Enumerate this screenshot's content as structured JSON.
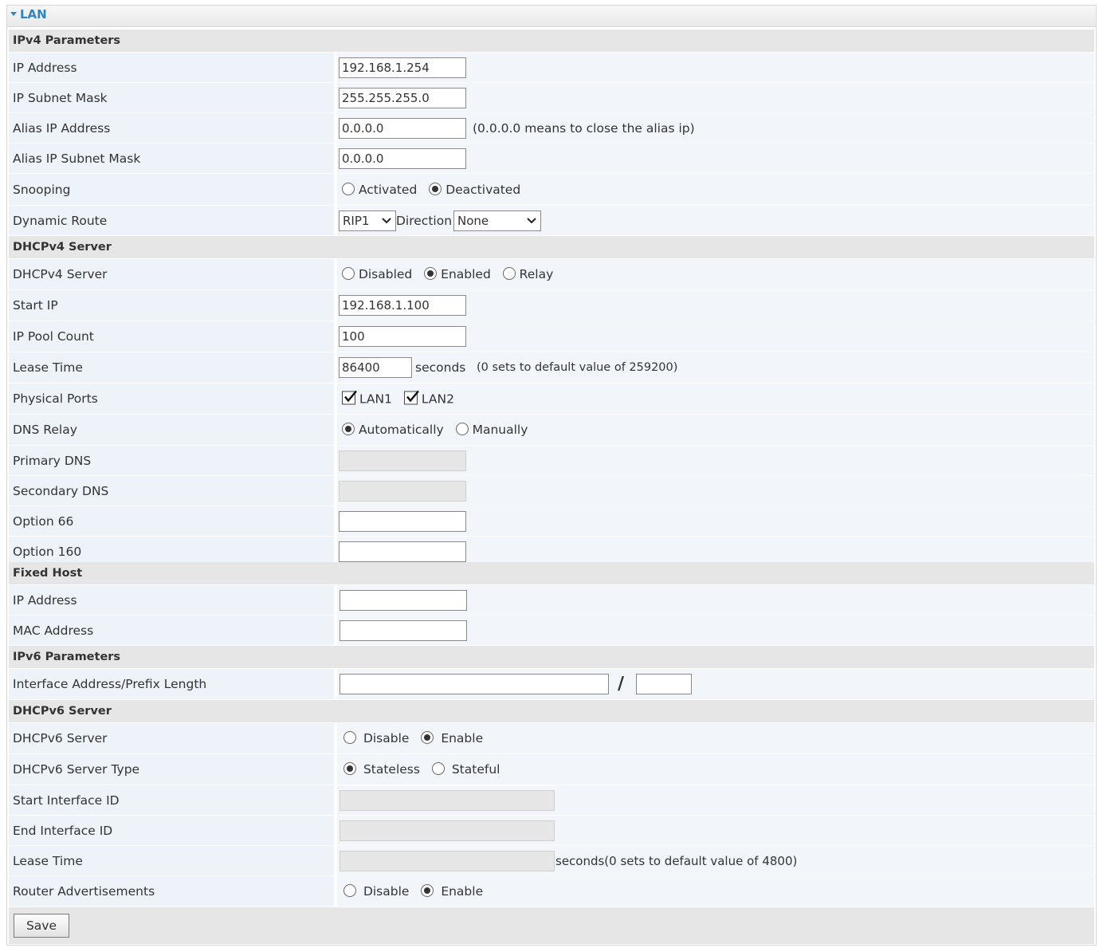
{
  "panel": {
    "title": "LAN"
  },
  "sections": {
    "ipv4": "IPv4 Parameters",
    "dhcpv4": "DHCPv4 Server",
    "fixed_host": "Fixed Host",
    "ipv6": "IPv6 Parameters",
    "dhcpv6": "DHCPv6 Server"
  },
  "ipv4": {
    "ip_address": {
      "label": "IP Address",
      "value": "192.168.1.254"
    },
    "subnet_mask": {
      "label": "IP Subnet Mask",
      "value": "255.255.255.0"
    },
    "alias_ip": {
      "label": "Alias IP Address",
      "value": "0.0.0.0",
      "hint": "(0.0.0.0 means to close the alias ip)"
    },
    "alias_mask": {
      "label": "Alias IP Subnet Mask",
      "value": "0.0.0.0"
    },
    "snooping": {
      "label": "Snooping",
      "options": [
        "Activated",
        "Deactivated"
      ],
      "selected": "Deactivated"
    },
    "dynamic_route": {
      "label": "Dynamic Route",
      "rip": "RIP1",
      "direction_label": "Direction",
      "direction": "None"
    }
  },
  "dhcpv4": {
    "server": {
      "label": "DHCPv4 Server",
      "options": [
        "Disabled",
        "Enabled",
        "Relay"
      ],
      "selected": "Enabled"
    },
    "start_ip": {
      "label": "Start IP",
      "value": "192.168.1.100"
    },
    "pool_count": {
      "label": "IP Pool Count",
      "value": "100"
    },
    "lease_time": {
      "label": "Lease Time",
      "value": "86400",
      "unit": "seconds",
      "hint": "(0 sets to default value of 259200)"
    },
    "physical_ports": {
      "label": "Physical Ports",
      "ports": [
        "LAN1",
        "LAN2"
      ],
      "checked": [
        true,
        true
      ]
    },
    "dns_relay": {
      "label": "DNS Relay",
      "options": [
        "Automatically",
        "Manually"
      ],
      "selected": "Automatically"
    },
    "primary_dns": {
      "label": "Primary DNS",
      "value": ""
    },
    "secondary_dns": {
      "label": "Secondary DNS",
      "value": ""
    },
    "option66": {
      "label": "Option 66",
      "value": ""
    },
    "option160": {
      "label": "Option 160",
      "value": ""
    }
  },
  "fixed_host": {
    "ip_address": {
      "label": "IP Address",
      "value": ""
    },
    "mac_address": {
      "label": "MAC Address",
      "value": ""
    }
  },
  "ipv6": {
    "interface_address": {
      "label": "Interface Address/Prefix Length",
      "value": "",
      "separator": "/",
      "prefix": ""
    }
  },
  "dhcpv6": {
    "server": {
      "label": "DHCPv6 Server",
      "options": [
        "Disable",
        "Enable"
      ],
      "selected": "Enable"
    },
    "server_type": {
      "label": "DHCPv6 Server Type",
      "options": [
        "Stateless",
        "Stateful"
      ],
      "selected": "Stateless"
    },
    "start_id": {
      "label": "Start Interface ID",
      "value": ""
    },
    "end_id": {
      "label": "End Interface ID",
      "value": ""
    },
    "lease_time": {
      "label": "Lease Time",
      "value": "",
      "hint": "seconds(0 sets to default value of 4800)"
    },
    "router_adv": {
      "label": "Router Advertisements",
      "options": [
        "Disable",
        "Enable"
      ],
      "selected": "Enable"
    }
  },
  "actions": {
    "save": "Save"
  }
}
